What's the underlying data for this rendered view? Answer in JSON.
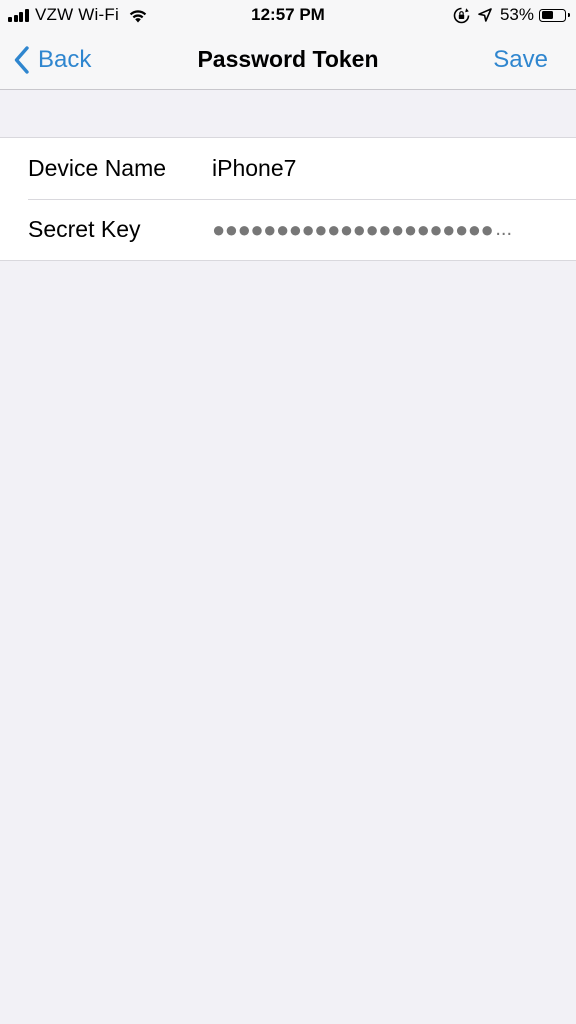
{
  "status_bar": {
    "carrier": "VZW Wi-Fi",
    "time": "12:57 PM",
    "battery_percent": "53%",
    "battery_level": 0.53
  },
  "nav": {
    "back_label": "Back",
    "title": "Password Token",
    "save_label": "Save"
  },
  "form": {
    "rows": [
      {
        "label": "Device Name",
        "value": "iPhone7"
      },
      {
        "label": "Secret Key",
        "value": "●●●●●●●●●●●●●●●●●●●●●●",
        "ellipsis": "..."
      }
    ]
  },
  "colors": {
    "accent": "#2f86cf",
    "background": "#f2f1f6",
    "cell": "#ffffff",
    "separator": "#d9d8dd"
  },
  "icons": {
    "signal": "signal-bars-icon",
    "wifi": "wifi-icon",
    "rotation_lock": "rotation-lock-icon",
    "location": "location-arrow-icon",
    "battery": "battery-icon",
    "back": "chevron-left-icon"
  }
}
